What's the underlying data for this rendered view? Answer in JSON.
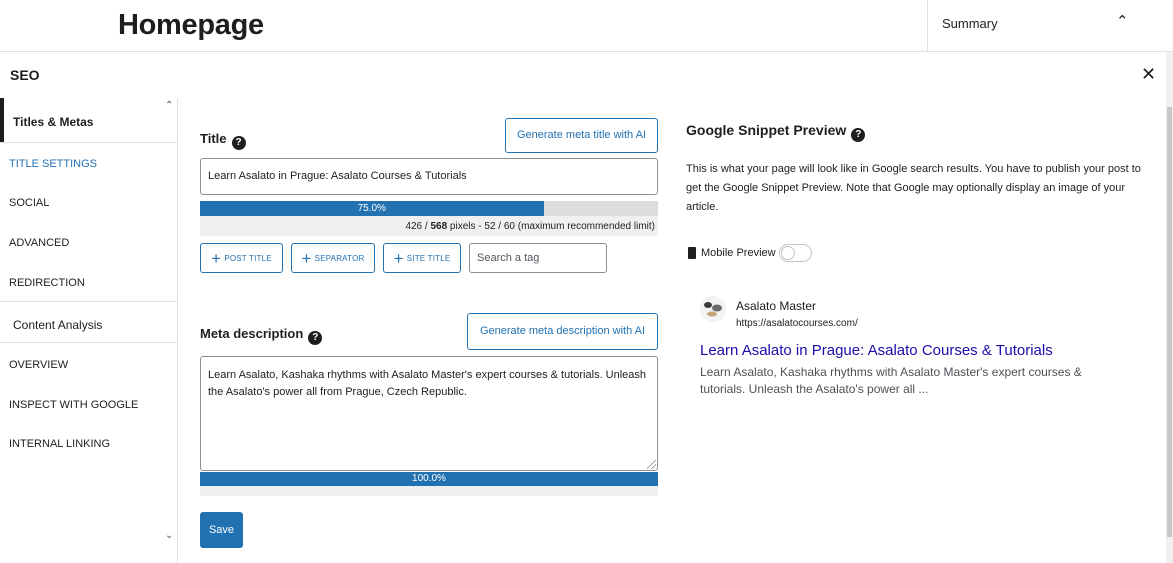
{
  "header": {
    "page_title": "Homepage",
    "summary_label": "Summary"
  },
  "seo_panel": {
    "title": "SEO"
  },
  "sidebar": {
    "items": [
      {
        "label": "Titles & Metas",
        "kind": "section",
        "active": true
      },
      {
        "label": "TITLE SETTINGS",
        "kind": "item",
        "active": true
      },
      {
        "label": "SOCIAL",
        "kind": "item"
      },
      {
        "label": "ADVANCED",
        "kind": "item"
      },
      {
        "label": "REDIRECTION",
        "kind": "item"
      },
      {
        "label": "Content Analysis",
        "kind": "section"
      },
      {
        "label": "OVERVIEW",
        "kind": "item"
      },
      {
        "label": "INSPECT WITH GOOGLE",
        "kind": "item"
      },
      {
        "label": "INTERNAL LINKING",
        "kind": "item"
      }
    ]
  },
  "title_field": {
    "label": "Title",
    "help": "?",
    "ai_button": "Generate meta title with AI",
    "value": "Learn Asalato in Prague: Asalato Courses & Tutorials",
    "progress": 0.75,
    "progress_label": "75.0%",
    "pixel_note_prefix": "426 / ",
    "pixel_note_bold": "568",
    "pixel_note_suffix": " pixels - 52 / 60 (maximum recommended limit)",
    "tag_buttons": [
      "POST TITLE",
      "SEPARATOR",
      "SITE TITLE"
    ],
    "tag_search_placeholder": "Search a tag"
  },
  "meta_field": {
    "label": "Meta description",
    "help": "?",
    "ai_button": "Generate meta description with AI",
    "value": "Learn Asalato, Kashaka rhythms with Asalato Master's expert courses & tutorials. Unleash the Asalato's power all from Prague, Czech Republic.",
    "progress": 1.0,
    "progress_label": "100.0%"
  },
  "save_label": "Save",
  "snippet": {
    "title": "Google Snippet Preview",
    "help": "?",
    "description": "This is what your page will look like in Google search results. You have to publish your post to get the Google Snippet Preview. Note that Google may optionally display an image of your article.",
    "mobile_label": "Mobile Preview",
    "mobile_enabled": false,
    "site_name": "Asalato Master",
    "site_url": "https://asalatocourses.com/",
    "serp_title": "Learn Asalato in Prague: Asalato Courses & Tutorials",
    "serp_desc": "Learn Asalato, Kashaka rhythms with Asalato Master's expert courses & tutorials. Unleash the Asalato's power all ..."
  },
  "colors": {
    "accent": "#2271b1",
    "link": "#1a0dab"
  }
}
